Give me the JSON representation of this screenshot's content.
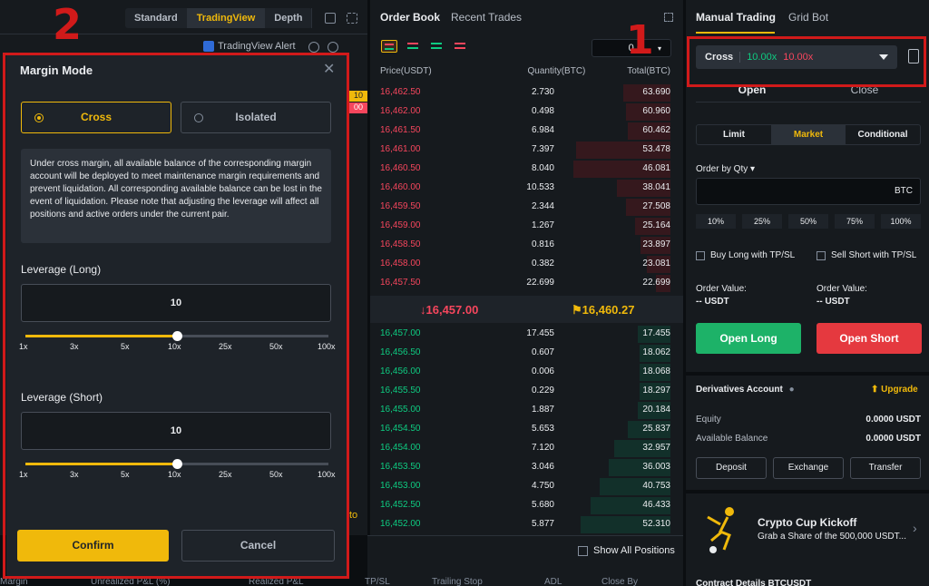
{
  "chart": {
    "tabs": [
      "Standard",
      "TradingView",
      "Depth"
    ],
    "tv_alert": "TradingView Alert",
    "price_tags": [
      "10",
      "00"
    ],
    "side_text": "to"
  },
  "orderbook": {
    "tabs": [
      "Order Book",
      "Recent Trades"
    ],
    "precision": "0.5",
    "head": {
      "price": "Price(USDT)",
      "qty": "Quantity(BTC)",
      "total": "Total(BTC)"
    },
    "asks": [
      {
        "price": "16,462.50",
        "qty": "2.730",
        "total": "63.690",
        "depth": 0.4
      },
      {
        "price": "16,462.00",
        "qty": "0.498",
        "total": "60.960",
        "depth": 0.38
      },
      {
        "price": "16,461.50",
        "qty": "6.984",
        "total": "60.462",
        "depth": 0.36
      },
      {
        "price": "16,461.00",
        "qty": "7.397",
        "total": "53.478",
        "depth": 0.8
      },
      {
        "price": "16,460.50",
        "qty": "8.040",
        "total": "46.081",
        "depth": 0.82
      },
      {
        "price": "16,460.00",
        "qty": "10.533",
        "total": "38.041",
        "depth": 0.45
      },
      {
        "price": "16,459.50",
        "qty": "2.344",
        "total": "27.508",
        "depth": 0.38
      },
      {
        "price": "16,459.00",
        "qty": "1.267",
        "total": "25.164",
        "depth": 0.3
      },
      {
        "price": "16,458.50",
        "qty": "0.816",
        "total": "23.897",
        "depth": 0.25
      },
      {
        "price": "16,458.00",
        "qty": "0.382",
        "total": "23.081",
        "depth": 0.2
      },
      {
        "price": "16,457.50",
        "qty": "22.699",
        "total": "22.699",
        "depth": 0.12
      }
    ],
    "last_price": "↓16,457.00",
    "mark_price": "⚑16,460.27",
    "bids": [
      {
        "price": "16,457.00",
        "qty": "17.455",
        "total": "17.455",
        "depth": 0.28
      },
      {
        "price": "16,456.50",
        "qty": "0.607",
        "total": "18.062",
        "depth": 0.26
      },
      {
        "price": "16,456.00",
        "qty": "0.006",
        "total": "18.068",
        "depth": 0.26
      },
      {
        "price": "16,455.50",
        "qty": "0.229",
        "total": "18.297",
        "depth": 0.26
      },
      {
        "price": "16,455.00",
        "qty": "1.887",
        "total": "20.184",
        "depth": 0.28
      },
      {
        "price": "16,454.50",
        "qty": "5.653",
        "total": "25.837",
        "depth": 0.36
      },
      {
        "price": "16,454.00",
        "qty": "7.120",
        "total": "32.957",
        "depth": 0.48
      },
      {
        "price": "16,453.50",
        "qty": "3.046",
        "total": "36.003",
        "depth": 0.52
      },
      {
        "price": "16,453.00",
        "qty": "4.750",
        "total": "40.753",
        "depth": 0.6
      },
      {
        "price": "16,452.50",
        "qty": "5.680",
        "total": "46.433",
        "depth": 0.68
      },
      {
        "price": "16,452.00",
        "qty": "5.877",
        "total": "52.310",
        "depth": 0.76
      }
    ]
  },
  "positions": {
    "show_all": "Show All Positions",
    "columns": [
      "Margin",
      "Unrealized P&L (%)",
      "Realized P&L",
      "TP/SL",
      "Trailing Stop",
      "ADL",
      "Close By"
    ]
  },
  "trading": {
    "tabs": [
      "Manual Trading",
      "Grid Bot"
    ],
    "margin_mode": "Cross",
    "lev_long": "10.00x",
    "lev_short": "10.00x",
    "open_label": "Open",
    "close_label": "Close",
    "order_types": [
      "Limit",
      "Market",
      "Conditional"
    ],
    "order_by": "Order by Qty ▾",
    "qty_unit": "BTC",
    "percents": [
      "10%",
      "25%",
      "50%",
      "75%",
      "100%"
    ],
    "buy_tpsl": "Buy Long with TP/SL",
    "sell_tpsl": "Sell Short with TP/SL",
    "order_value_label": "Order Value:",
    "order_value": "-- USDT",
    "open_long": "Open Long",
    "open_short": "Open Short",
    "account_title": "Derivatives Account",
    "upgrade": "Upgrade",
    "equity_label": "Equity",
    "equity_value": "0.0000 USDT",
    "avail_label": "Available Balance",
    "avail_value": "0.0000 USDT",
    "acct_buttons": [
      "Deposit",
      "Exchange",
      "Transfer"
    ],
    "promo_title": "Crypto Cup Kickoff",
    "promo_sub": "Grab a Share of the 500,000 USDT...",
    "contract_details": "Contract Details BTCUSDT"
  },
  "modal": {
    "title": "Margin Mode",
    "cross_label": "Cross",
    "isolated_label": "Isolated",
    "description": "Under cross margin, all available balance of the corresponding margin account will be deployed to meet maintenance margin requirements and prevent liquidation. All corresponding available balance can be lost in the event of liquidation. Please note that adjusting the leverage will affect all positions and active orders under the current pair.",
    "long_label": "Leverage (Long)",
    "long_value": "10",
    "long_level": 0.5,
    "short_label": "Leverage (Short)",
    "short_value": "10",
    "short_level": 0.5,
    "ticks": [
      "1x",
      "3x",
      "5x",
      "10x",
      "25x",
      "50x",
      "100x"
    ],
    "confirm": "Confirm",
    "cancel": "Cancel"
  },
  "annotations": {
    "one": "1",
    "two": "2",
    "color": "#d11a1a"
  }
}
